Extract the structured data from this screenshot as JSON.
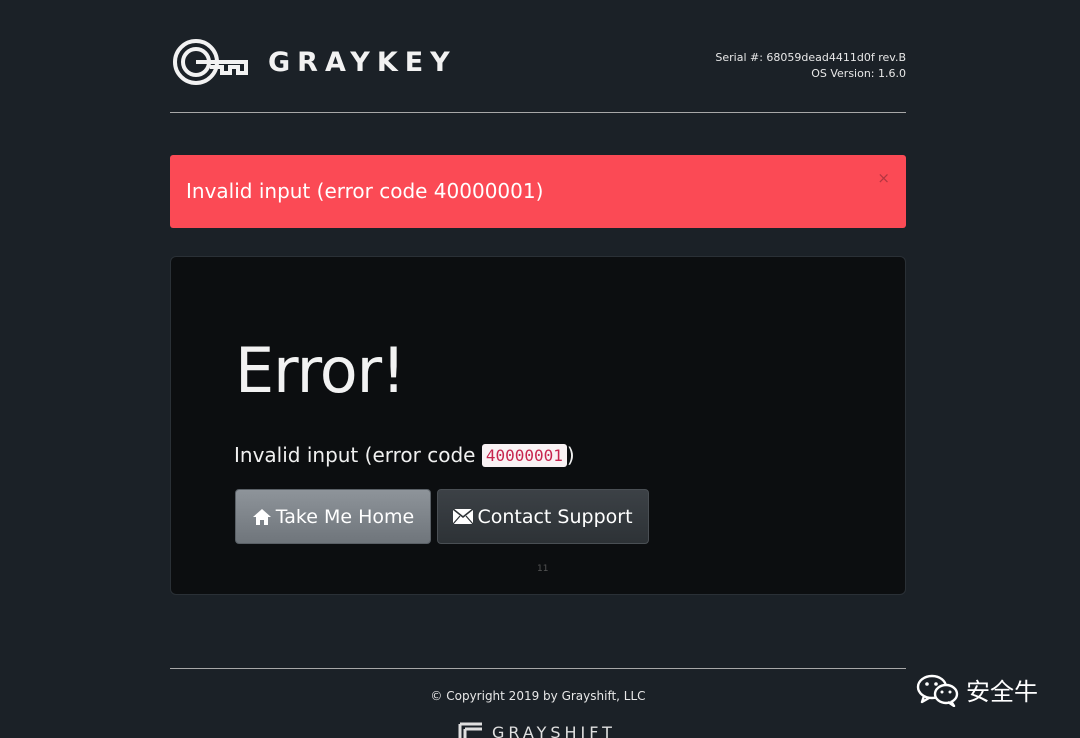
{
  "header": {
    "brand": "GRAYKEY",
    "serial_label": "Serial #: 68059dead4411d0f rev.B",
    "os_version_label": "OS Version: 1.6.0"
  },
  "alert": {
    "message": "Invalid input (error code 40000001)",
    "close_symbol": "×",
    "color": "#fb4a55"
  },
  "panel": {
    "title": "Error!",
    "message_prefix": "Invalid input (error code ",
    "error_code": "40000001",
    "message_suffix": ")",
    "marker": "11",
    "buttons": [
      {
        "label": "Take Me Home",
        "icon": "home-icon"
      },
      {
        "label": "Contact Support",
        "icon": "envelope-icon"
      }
    ]
  },
  "footer": {
    "copyright": "© Copyright 2019 by Grayshift, LLC",
    "brand": "GRAYSHIFT"
  },
  "watermark": {
    "text": "安全牛",
    "icon": "wechat-icon"
  }
}
